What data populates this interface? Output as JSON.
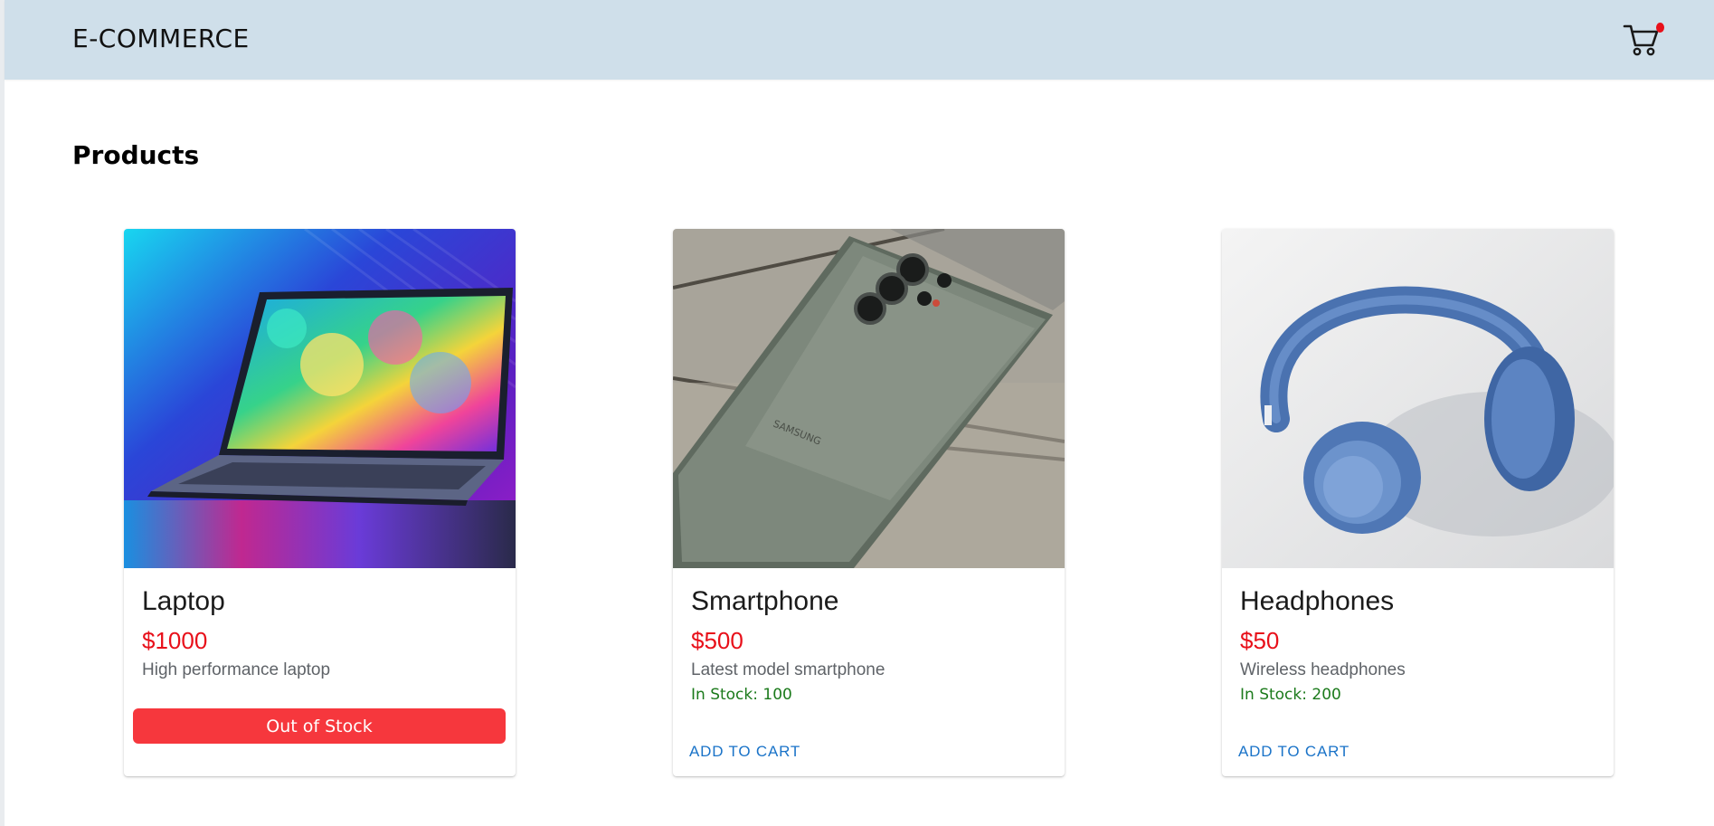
{
  "appbar": {
    "brand": "E-COMMERCE",
    "cart_badge_color": "#e8101a",
    "background": "#cfdfea"
  },
  "page": {
    "title": "Products"
  },
  "products": [
    {
      "name": "Laptop",
      "price": "$1000",
      "description": "High performance laptop",
      "stock_text": "",
      "action_label": "Out of Stock",
      "in_stock": false,
      "image_icon": "laptop-image"
    },
    {
      "name": "Smartphone",
      "price": "$500",
      "description": "Latest model smartphone",
      "stock_text": "In Stock: 100",
      "action_label": "ADD TO CART",
      "in_stock": true,
      "image_icon": "smartphone-image"
    },
    {
      "name": "Headphones",
      "price": "$50",
      "description": "Wireless headphones",
      "stock_text": "In Stock: 200",
      "action_label": "ADD TO CART",
      "in_stock": true,
      "image_icon": "headphones-image"
    }
  ],
  "colors": {
    "price": "#e8101a",
    "in_stock": "#1b7a1b",
    "add_to_cart": "#1a73c8",
    "out_of_stock": "#f6373d"
  }
}
